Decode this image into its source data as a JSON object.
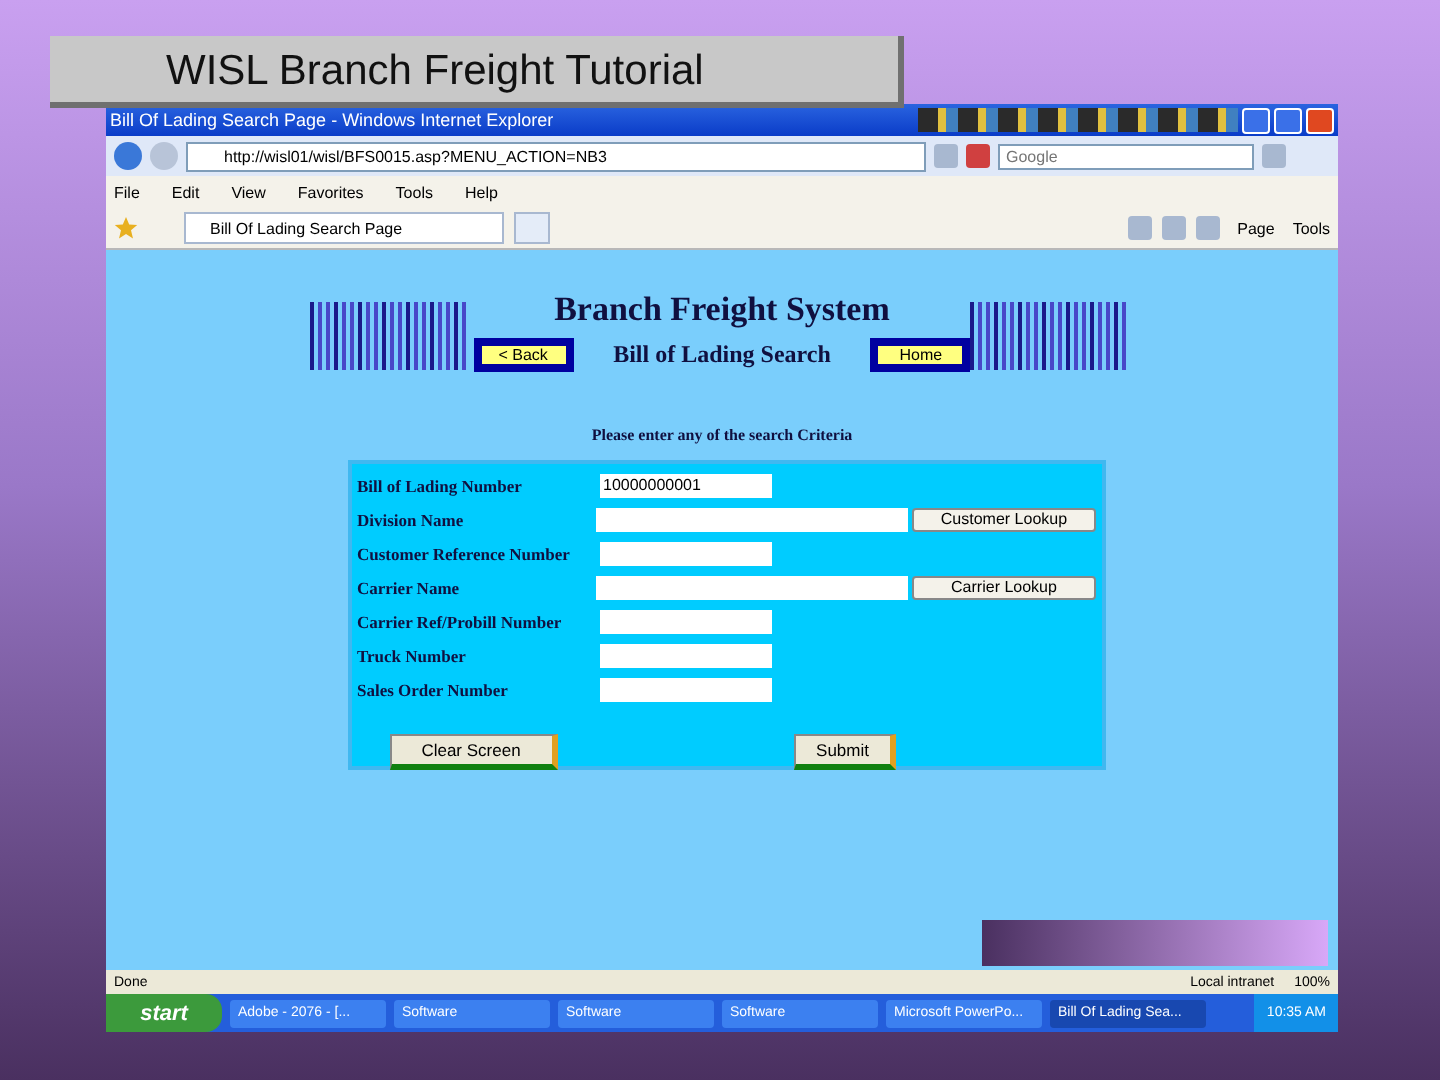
{
  "slide": {
    "title": "WISL Branch Freight Tutorial"
  },
  "window": {
    "title": "Bill Of Lading Search Page - Windows Internet Explorer"
  },
  "address_bar": {
    "value": "http://wisl01/wisl/BFS0015.asp?MENU_ACTION=NB3"
  },
  "search": {
    "placeholder": "Google"
  },
  "menu": [
    "File",
    "Edit",
    "View",
    "Favorites",
    "Tools",
    "Help"
  ],
  "tab": {
    "label": "Bill Of Lading Search Page"
  },
  "command_bar": [
    "Page",
    "Tools"
  ],
  "page": {
    "heading": "Branch Freight System",
    "subheading": "Bill of Lading Search",
    "back_button": "< Back",
    "home_button": "Home",
    "instructions": "Please enter any of the search Criteria",
    "fields": [
      {
        "label": "Bill of Lading Number",
        "kind": "short",
        "value": "10000000001"
      },
      {
        "label": "Division Name",
        "kind": "long",
        "lookup": "Customer Lookup"
      },
      {
        "label": "Customer Reference Number",
        "kind": "short"
      },
      {
        "label": "Carrier Name",
        "kind": "long",
        "lookup": "Carrier Lookup"
      },
      {
        "label": "Carrier Ref/Probill Number",
        "kind": "short"
      },
      {
        "label": "Truck Number",
        "kind": "short"
      },
      {
        "label": "Sales Order Number",
        "kind": "short"
      }
    ],
    "clear_button": "Clear Screen",
    "submit_button": "Submit"
  },
  "status_bar": {
    "status": "Done",
    "zone": "Local intranet",
    "zoom": "100%"
  },
  "taskbar": {
    "start": "start",
    "items": [
      {
        "label": "Adobe - 2076 - [...",
        "selected": false
      },
      {
        "label": "Software",
        "selected": false
      },
      {
        "label": "Software",
        "selected": false
      },
      {
        "label": "Software",
        "selected": false
      },
      {
        "label": "Microsoft PowerPo...",
        "selected": false
      },
      {
        "label": "Bill Of Lading Sea...",
        "selected": true
      }
    ],
    "clock": "10:35 AM"
  }
}
